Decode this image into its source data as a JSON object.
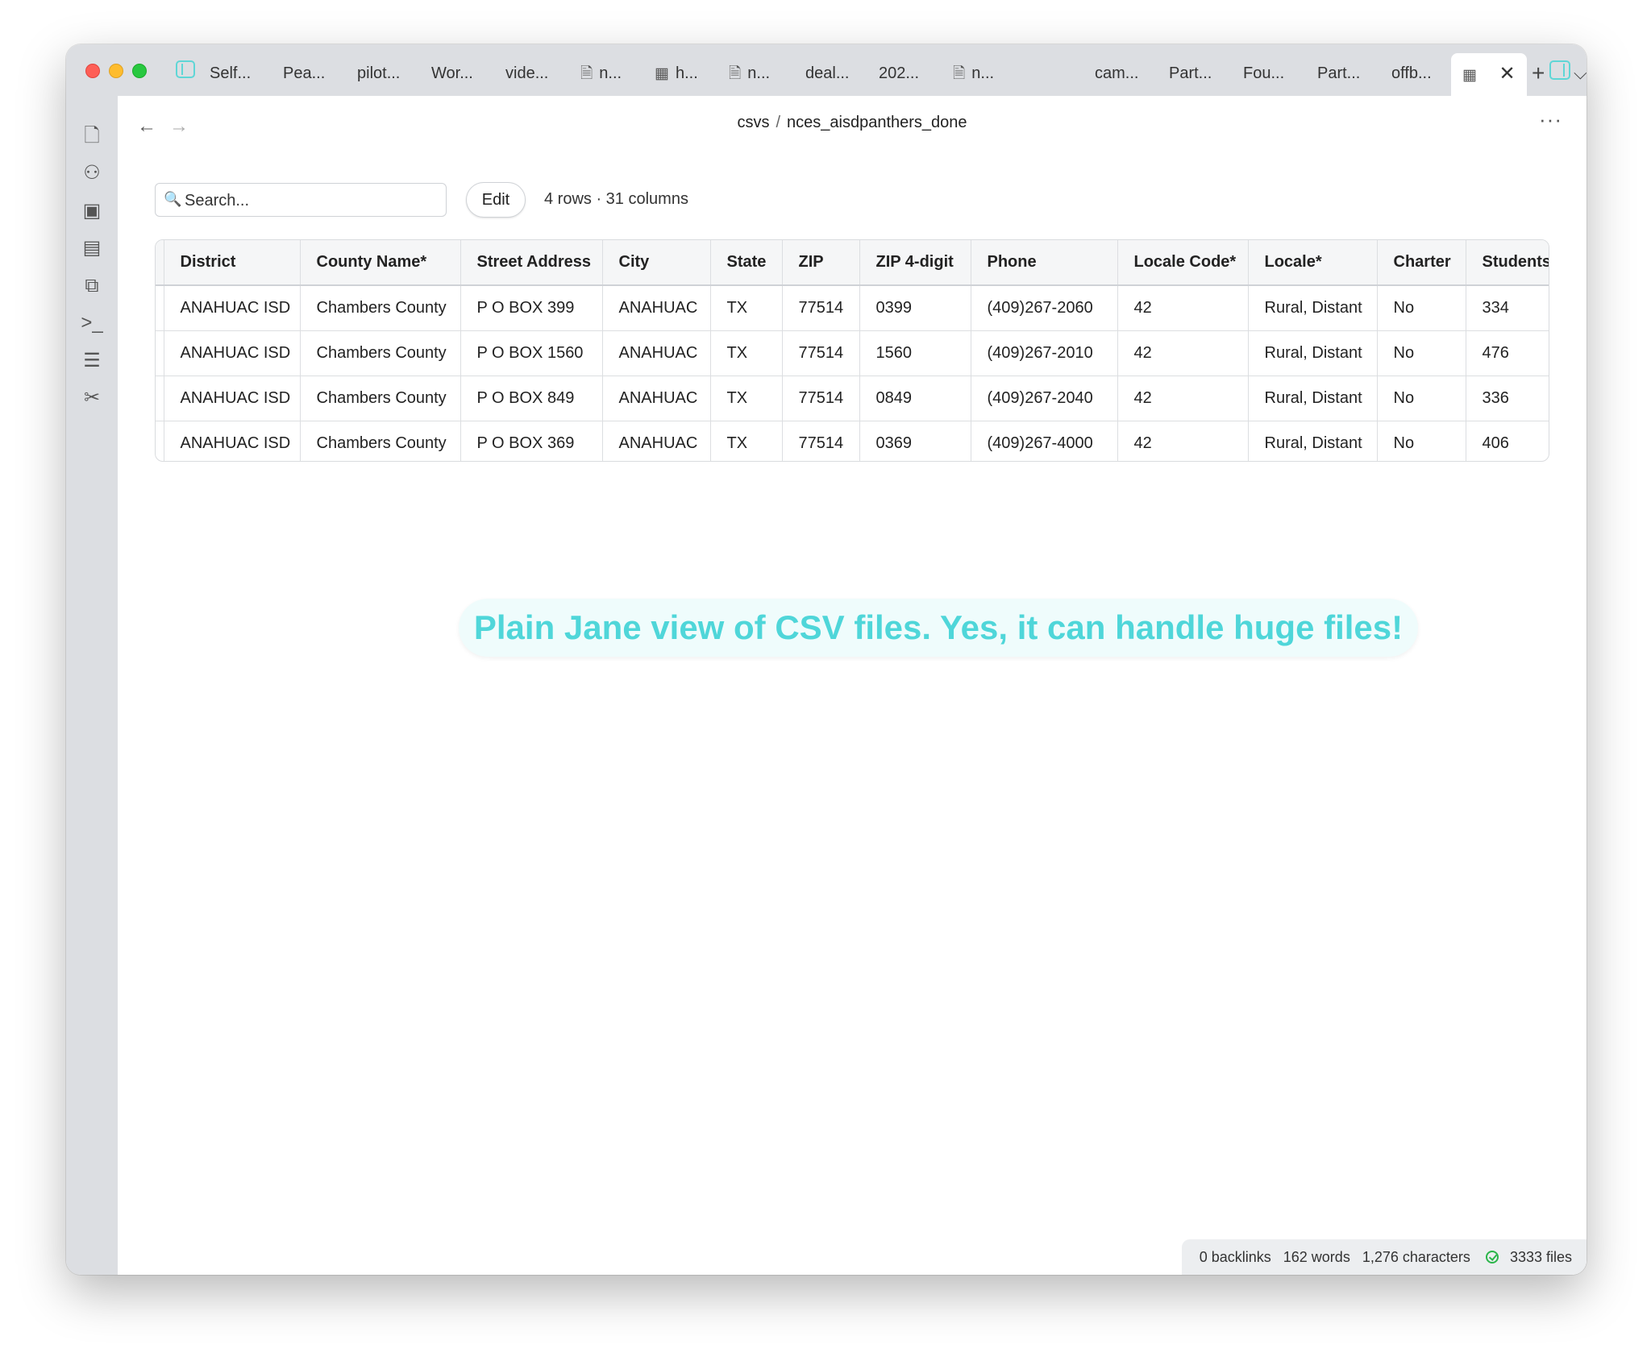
{
  "tabs": [
    {
      "label": "Self...",
      "icon": ""
    },
    {
      "label": "Pea...",
      "icon": ""
    },
    {
      "label": "pilot...",
      "icon": ""
    },
    {
      "label": "Wor...",
      "icon": ""
    },
    {
      "label": "vide...",
      "icon": ""
    },
    {
      "label": "n...",
      "icon": "document-icon"
    },
    {
      "label": "h...",
      "icon": "table-icon"
    },
    {
      "label": "n...",
      "icon": "document-icon"
    },
    {
      "label": "deal...",
      "icon": ""
    },
    {
      "label": "202...",
      "icon": ""
    },
    {
      "label": "n...",
      "icon": "document-icon"
    },
    {
      "label": "cam...",
      "icon": ""
    },
    {
      "label": "Part...",
      "icon": ""
    },
    {
      "label": "Fou...",
      "icon": ""
    },
    {
      "label": "Part...",
      "icon": ""
    },
    {
      "label": "offb...",
      "icon": ""
    }
  ],
  "breadcrumb": {
    "folder": "csvs",
    "separator": "/",
    "file": "nces_aisdpanthers_done"
  },
  "toolbar": {
    "search_placeholder": "Search...",
    "edit_label": "Edit",
    "row_count": "4 rows · 31 columns"
  },
  "table": {
    "columns": [
      "District",
      "County Name*",
      "Street Address",
      "City",
      "State",
      "ZIP",
      "ZIP 4-digit",
      "Phone",
      "Locale Code*",
      "Locale*",
      "Charter",
      "Students"
    ],
    "rows": [
      [
        "ANAHUAC ISD",
        "Chambers County",
        "P O BOX 399",
        "ANAHUAC",
        "TX",
        "77514",
        "0399",
        "(409)267-2060",
        "42",
        "Rural, Distant",
        "No",
        "334"
      ],
      [
        "ANAHUAC ISD",
        "Chambers County",
        "P O BOX 1560",
        "ANAHUAC",
        "TX",
        "77514",
        "1560",
        "(409)267-2010",
        "42",
        "Rural, Distant",
        "No",
        "476"
      ],
      [
        "ANAHUAC ISD",
        "Chambers County",
        "P O BOX 849",
        "ANAHUAC",
        "TX",
        "77514",
        "0849",
        "(409)267-2040",
        "42",
        "Rural, Distant",
        "No",
        "336"
      ],
      [
        "ANAHUAC ISD",
        "Chambers County",
        "P O BOX 369",
        "ANAHUAC",
        "TX",
        "77514",
        "0369",
        "(409)267-4000",
        "42",
        "Rural, Distant",
        "No",
        "406"
      ]
    ]
  },
  "caption": "Plain Jane view of CSV files. Yes, it can handle huge files!",
  "status": {
    "backlinks": "0 backlinks",
    "words": "162 words",
    "characters": "1,276 characters",
    "files": "3333 files"
  },
  "colors": {
    "accent": "#4fd6d9",
    "sync_ok": "#2bb54a"
  }
}
